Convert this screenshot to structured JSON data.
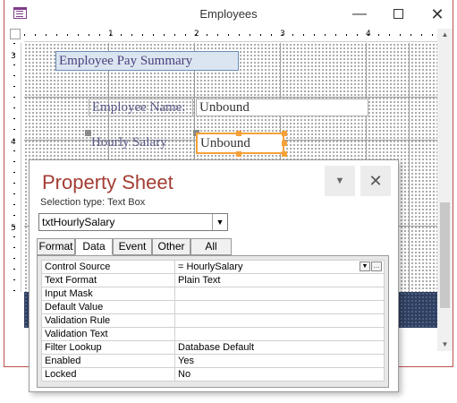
{
  "window": {
    "title": "Employees"
  },
  "ruler": {
    "top_numbers": [
      "1",
      "2",
      "3",
      "4"
    ],
    "side_numbers": [
      "3",
      "4",
      "5"
    ]
  },
  "form": {
    "title_label": "Employee Pay Summary",
    "employee_name_label": "Employee Name:",
    "employee_name_value": "Unbound",
    "hourly_salary_label": "Hourly Salary",
    "hourly_salary_value": "Unbound"
  },
  "property_sheet": {
    "title": "Property Sheet",
    "selection_type": "Selection type:  Text Box",
    "selected_object": "txtHourlySalary",
    "tabs": [
      "Format",
      "Data",
      "Event",
      "Other",
      "All"
    ],
    "active_tab": "Data",
    "properties": [
      {
        "name": "Control Source",
        "value": "= HourlySalary"
      },
      {
        "name": "Text Format",
        "value": "Plain Text"
      },
      {
        "name": "Input Mask",
        "value": ""
      },
      {
        "name": "Default Value",
        "value": ""
      },
      {
        "name": "Validation Rule",
        "value": ""
      },
      {
        "name": "Validation Text",
        "value": ""
      },
      {
        "name": "Filter Lookup",
        "value": "Database Default"
      },
      {
        "name": "Enabled",
        "value": "Yes"
      },
      {
        "name": "Locked",
        "value": "No"
      }
    ]
  },
  "icons": {
    "app": "form-icon",
    "minimize": "minimize-icon",
    "maximize": "maximize-icon",
    "close": "close-icon"
  }
}
